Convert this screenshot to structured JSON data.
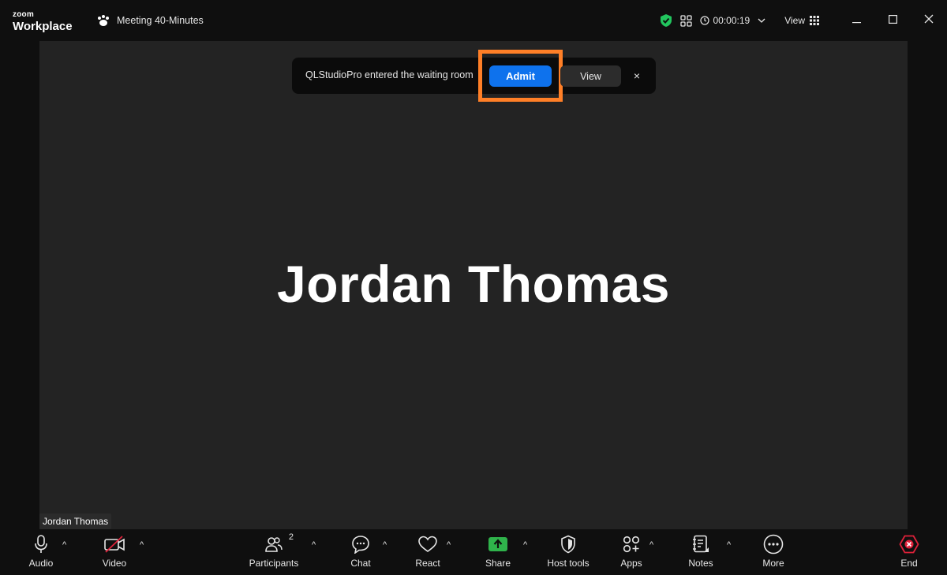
{
  "app": {
    "logo_top": "zoom",
    "logo_bottom": "Workplace"
  },
  "meeting": {
    "title": "Meeting 40-Minutes",
    "timer": "00:00:19",
    "view_label": "View"
  },
  "notification": {
    "message": "QLStudioPro entered the waiting room",
    "admit_label": "Admit",
    "view_label": "View",
    "close_label": "×"
  },
  "participant": {
    "display_name": "Jordan Thomas",
    "name_tag": "Jordan Thomas"
  },
  "toolbar": {
    "audio": "Audio",
    "video": "Video",
    "participants": "Participants",
    "participants_count": "2",
    "chat": "Chat",
    "react": "React",
    "share": "Share",
    "host_tools": "Host tools",
    "apps": "Apps",
    "notes": "Notes",
    "more": "More",
    "end": "End"
  },
  "colors": {
    "accent": "#0e72ed",
    "highlight": "#ff7f27",
    "share_green": "#2fb34b",
    "end_red": "#e0213a",
    "shield_green": "#22c55e"
  }
}
